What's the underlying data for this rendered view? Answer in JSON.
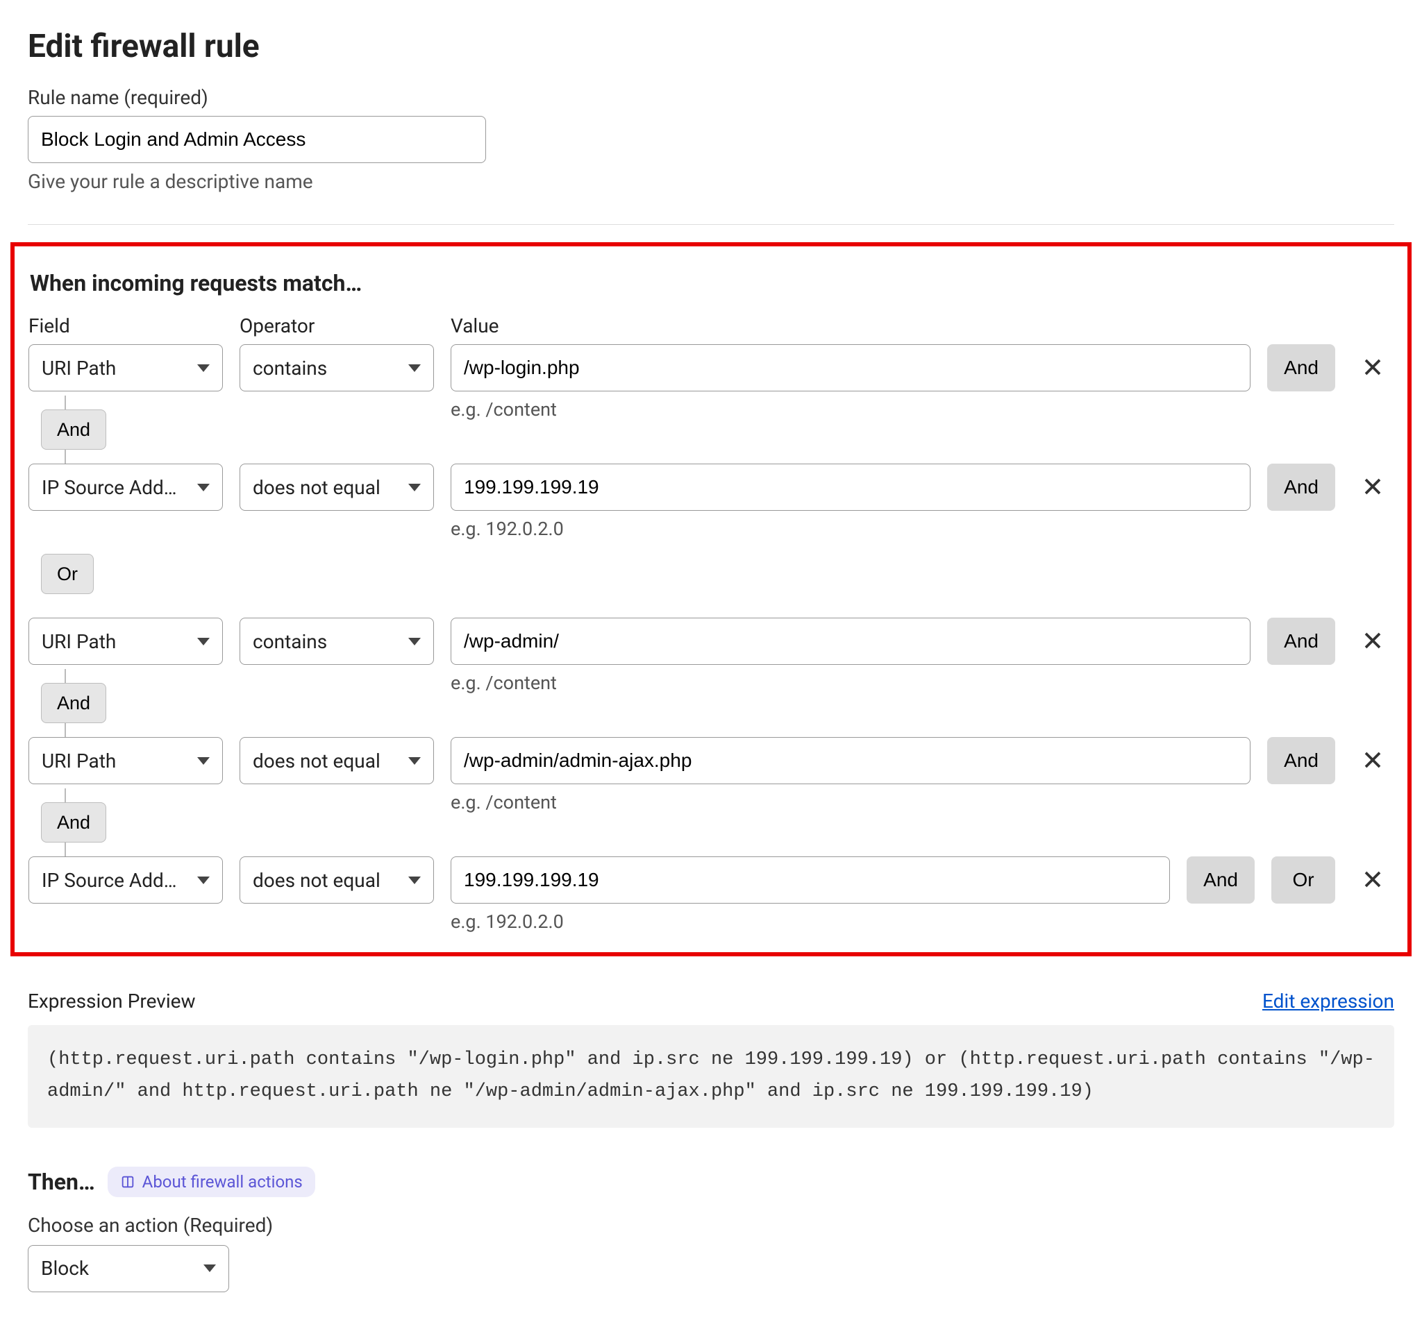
{
  "page": {
    "title": "Edit firewall rule",
    "rule_name_label": "Rule name (required)",
    "rule_name_value": "Block Login and Admin Access",
    "rule_name_help": "Give your rule a descriptive name"
  },
  "match": {
    "heading": "When incoming requests match…",
    "labels": {
      "field": "Field",
      "operator": "Operator",
      "value": "Value"
    },
    "rows": [
      {
        "field": "URI Path",
        "operator": "contains",
        "value": "/wp-login.php",
        "hint": "e.g. /content",
        "buttons": [
          "And"
        ],
        "connector_after": "And"
      },
      {
        "field": "IP Source Add…",
        "operator": "does not equal",
        "value": "199.199.199.19",
        "hint": "e.g. 192.0.2.0",
        "buttons": [
          "And"
        ],
        "connector_after": "Or"
      },
      {
        "field": "URI Path",
        "operator": "contains",
        "value": "/wp-admin/",
        "hint": "e.g. /content",
        "buttons": [
          "And"
        ],
        "connector_after": "And"
      },
      {
        "field": "URI Path",
        "operator": "does not equal",
        "value": "/wp-admin/admin-ajax.php",
        "hint": "e.g. /content",
        "buttons": [
          "And"
        ],
        "connector_after": "And"
      },
      {
        "field": "IP Source Add…",
        "operator": "does not equal",
        "value": "199.199.199.19",
        "hint": "e.g. 192.0.2.0",
        "buttons": [
          "And",
          "Or"
        ],
        "connector_after": null
      }
    ]
  },
  "preview": {
    "label": "Expression Preview",
    "edit": "Edit expression",
    "text": "(http.request.uri.path contains \"/wp-login.php\" and ip.src ne 199.199.199.19) or (http.request.uri.path contains \"/wp-admin/\" and http.request.uri.path ne \"/wp-admin/admin-ajax.php\" and ip.src ne 199.199.199.19)"
  },
  "then": {
    "label": "Then…",
    "info": "About firewall actions",
    "action_label": "Choose an action (Required)",
    "action_value": "Block"
  }
}
